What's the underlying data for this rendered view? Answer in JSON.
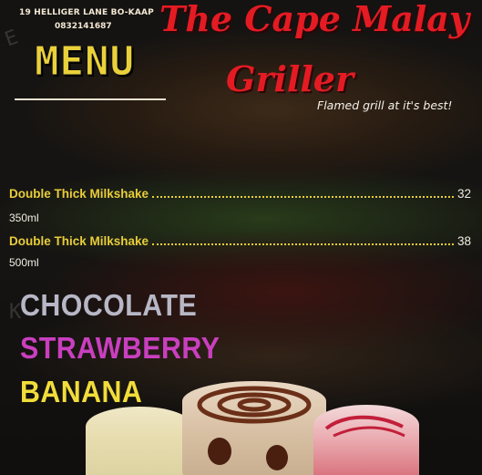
{
  "header": {
    "address": "19 HELLIGER LANE BO-KAAP",
    "phone": "0832141687",
    "menu_title": "MENU"
  },
  "brand": {
    "line1": "The Cape Malay",
    "line2": "Griller",
    "tagline": "Flamed grill at it's best!"
  },
  "items": [
    {
      "name": "Double Thick Milkshake",
      "price": "32",
      "size": "350ml"
    },
    {
      "name": "Double Thick Milkshake",
      "price": "38",
      "size": "500ml"
    }
  ],
  "flavors": [
    {
      "label": "CHOCOLATE",
      "color": "#b7b7c6"
    },
    {
      "label": "STRAWBERRY",
      "color": "#c93fbf"
    },
    {
      "label": "BANANA",
      "color": "#f1dd3a"
    }
  ],
  "colors": {
    "accent_yellow": "#ead13a",
    "brand_red": "#e41b23"
  }
}
